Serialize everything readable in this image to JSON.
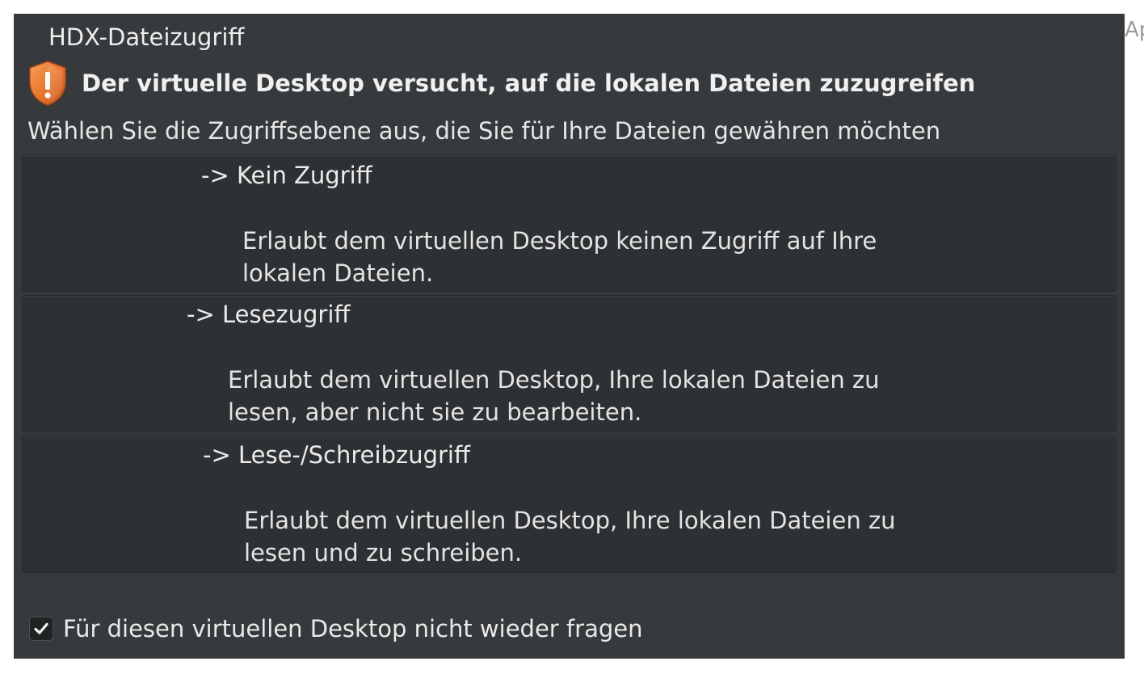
{
  "background": {
    "edge_text": "Ap"
  },
  "dialog": {
    "title": "HDX-Dateizugriff",
    "heading": "Der virtuelle Desktop versucht, auf die lokalen Dateien zuzugreifen",
    "subtitle": "Wählen Sie die Zugriffsebene aus, die Sie für Ihre Dateien gewähren möchten",
    "warning_icon": "shield-warning-icon",
    "options": [
      {
        "title": "-> Kein Zugriff",
        "description": "Erlaubt dem virtuellen Desktop keinen Zugriff auf Ihre\nlokalen Dateien."
      },
      {
        "title": "-> Lesezugriff",
        "description": "Erlaubt dem virtuellen Desktop, Ihre lokalen Dateien zu\nlesen, aber nicht sie zu bearbeiten."
      },
      {
        "title": "-> Lese-/Schreibzugriff",
        "description": "Erlaubt dem virtuellen Desktop, Ihre lokalen Dateien zu\nlesen und zu schreiben."
      }
    ],
    "dont_ask_again": {
      "label": "Für diesen virtuellen Desktop nicht wieder fragen",
      "checked": true
    }
  },
  "colors": {
    "dialog_bg": "#363a3c",
    "option_bg": "#2e3133",
    "text": "#e9e9e9",
    "shield_orange": "#e8732a"
  }
}
